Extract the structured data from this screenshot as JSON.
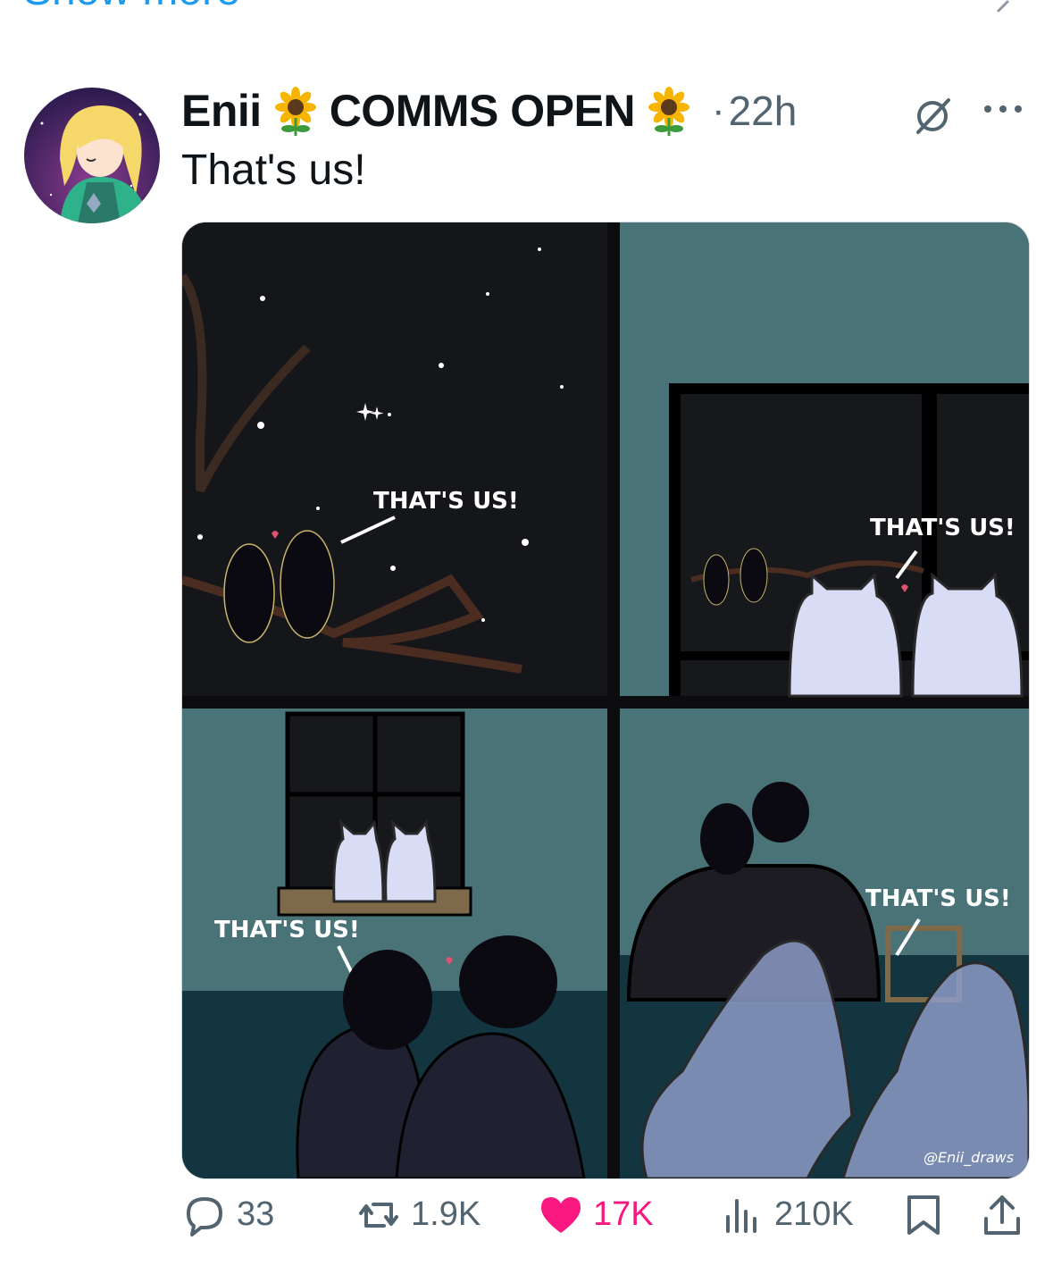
{
  "show_more_label": "Show more",
  "tweet": {
    "author_name": "Enii",
    "author_tag": "COMMS OPEN",
    "separator": "·",
    "time": "22h",
    "text": "That's us!"
  },
  "media": {
    "panel_texts": [
      "THAT'S US!",
      "THAT'S US!",
      "THAT'S US!",
      "THAT'S US!"
    ],
    "watermark": "@Enii_draws"
  },
  "actions": {
    "replies": "33",
    "reposts": "1.9K",
    "likes": "17K",
    "views": "210K"
  },
  "icons": {
    "emoji": "sunflower-icon",
    "reply": "reply-icon",
    "repost": "repost-icon",
    "like": "heart-icon",
    "views": "views-icon",
    "bookmark": "bookmark-icon",
    "share": "share-icon",
    "grok": "grok-icon",
    "more": "more-icon"
  },
  "colors": {
    "accent": "#1d9bf0",
    "like": "#f91880",
    "muted": "#536471"
  }
}
